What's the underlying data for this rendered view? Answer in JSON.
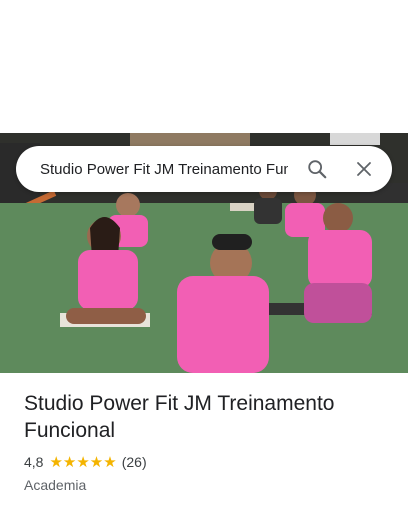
{
  "search": {
    "query": "Studio Power Fit JM Treinamento Funcional"
  },
  "icons": {
    "search": "search-icon",
    "close": "close-icon"
  },
  "place": {
    "title": "Studio Power Fit JM Treinamento Funcional",
    "rating": "4,8",
    "rating_value": 4.8,
    "stars": "★★★★★",
    "review_count": "(26)",
    "category": "Academia"
  },
  "colors": {
    "star": "#f4b400",
    "shirt": "#f25fb4",
    "floor": "#5d8a5a"
  }
}
